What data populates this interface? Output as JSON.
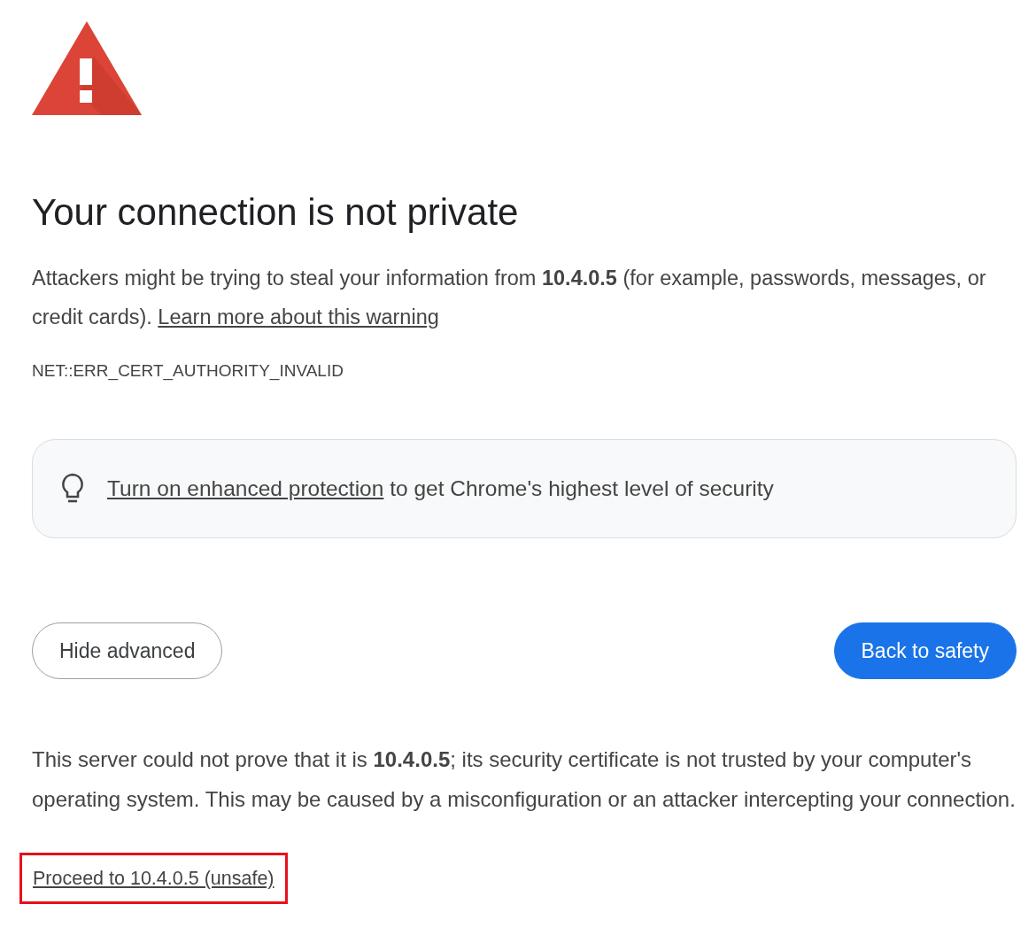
{
  "title": "Your connection is not private",
  "message": "Attackers might be trying to steal your information from **10.4.0.5** (for example, passwords, messages, or credit cards).",
  "learn_more_link": "Learn more about this warning",
  "error_code": "NET::ERR_CERT_AUTHORITY_INVALID",
  "enhanced_protection": {
    "link": "Turn on enhanced protection",
    "text": "to get Chrome's highest level of security"
  },
  "buttons": [
    {
      "label": "Hide advanced",
      "kind": "secondary"
    },
    {
      "label": "Back to safety",
      "kind": "primary"
    }
  ],
  "details": "This server could not prove that it is **10.4.0.5**; its security certificate is not trusted by your computer's operating system. This may be caused by a misconfiguration or an attacker intercepting your connection.",
  "proceed_link": {
    "label": "Proceed to 10.4.0.5 (unsafe)",
    "highlighted": true
  }
}
